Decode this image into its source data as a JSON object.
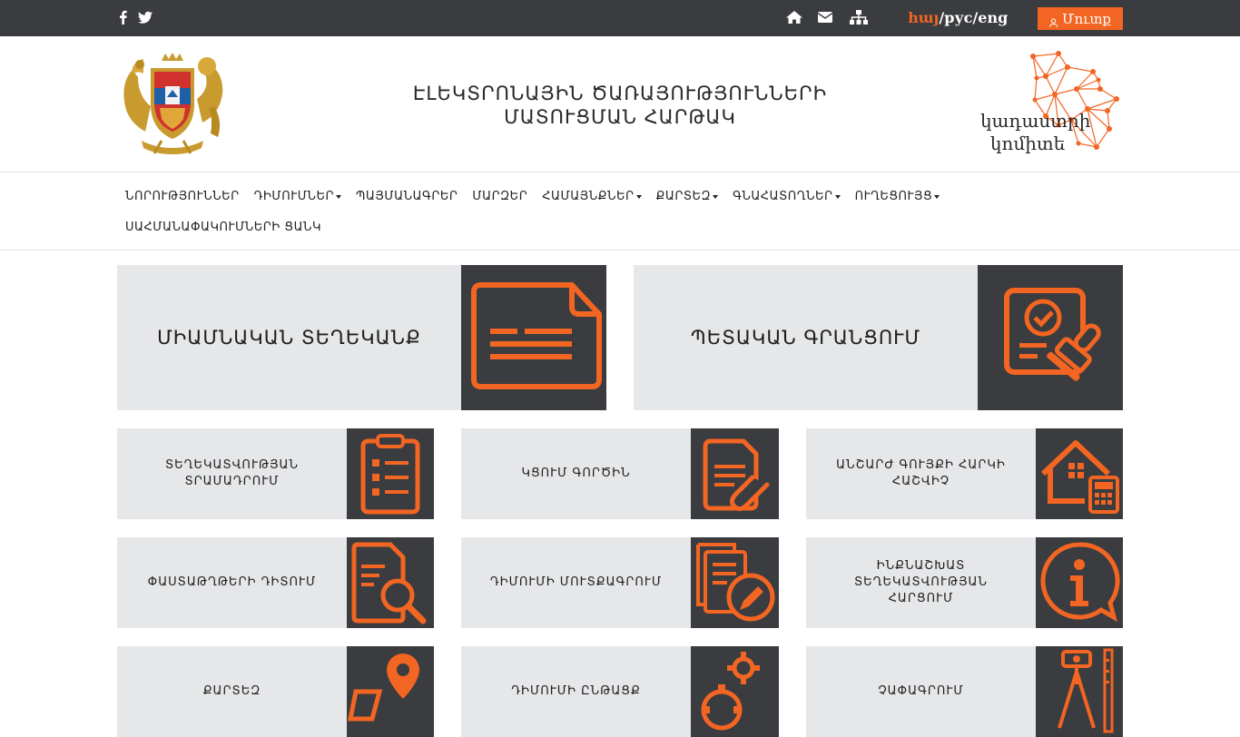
{
  "topbar": {
    "lang_arm": "հայ",
    "lang_sep1": "/",
    "lang_rus": "рус",
    "lang_sep2": "/",
    "lang_eng": "eng",
    "login_label": "Մուտք",
    "social_icons": [
      "facebook-icon",
      "twitter-icon"
    ],
    "util_icons": [
      "home-icon",
      "envelope-icon",
      "sitemap-icon"
    ]
  },
  "header": {
    "title_line1": "ԷԼԵԿՏՐՈՆԱՅԻՆ ԾԱՌԱՅՈՒԹՅՈՒՆՆԵՐԻ",
    "title_line2": "ՄԱՏՈՒՑՄԱՆ ՀԱՐԹԱԿ",
    "brand_line1": "կադաստրի",
    "brand_line2": "կոմիտե"
  },
  "nav": {
    "items": [
      {
        "label": "ՆՈՐՈՒԹՅՈՒՆՆԵՐ",
        "dropdown": false
      },
      {
        "label": "ԴԻՄՈՒՄՆԵՐ",
        "dropdown": true
      },
      {
        "label": "ՊԱՅՄԱՆԱԳՐԵՐ",
        "dropdown": false
      },
      {
        "label": "ՄԱՐԶԵՐ",
        "dropdown": false
      },
      {
        "label": "ՀԱՄԱՅՆՔՆԵՐ",
        "dropdown": true
      },
      {
        "label": "ՔԱՐՏԵԶ",
        "dropdown": true
      },
      {
        "label": "ԳՆԱՀԱՏՈՂՆԵՐ",
        "dropdown": true
      },
      {
        "label": "ՈՒՂԵՑՈՒՅՑ",
        "dropdown": true
      },
      {
        "label": "ՍԱՀՄԱՆԱՓԱԿՈՒՄՆԵՐԻ ՑԱՆԿ",
        "dropdown": false
      }
    ]
  },
  "tiles": {
    "big": [
      {
        "label": "ՄԻԱՄՆԱԿԱՆ ՏԵՂԵԿԱՆՔ",
        "icon": "document-card-icon"
      },
      {
        "label": "ՊԵՏԱԿԱՆ ԳՐԱՆՑՈՒՄ",
        "icon": "stamp-document-icon"
      }
    ],
    "small": [
      {
        "label": "ՏԵՂԵԿԱՏՎՈՒԹՅԱՆ ՏՐԱՄԱԴՐՈՒՄ",
        "icon": "clipboard-list-icon"
      },
      {
        "label": "ԿՑՈՒՄ ԳՈՐԾԻՆ",
        "icon": "document-paperclip-icon"
      },
      {
        "label": "ԱՆՇԱՐԺ ԳՈՒՅՔԻ ՀԱՐԿԻ ՀԱՇՎԻՉ",
        "icon": "house-calculator-icon"
      },
      {
        "label": "ՓԱՍՏԱԹՂԹԵՐԻ ԴԻՏՈՒՄ",
        "icon": "document-search-icon"
      },
      {
        "label": "ԴԻՄՈՒՄԻ ՄՈՒՏՔԱԳՐՈՒՄ",
        "icon": "documents-pencil-icon"
      },
      {
        "label": "ԻՆՔՆԱՇԽԱՏ ՏԵՂԵԿԱՏՎՈՒԹՅԱՆ ՀԱՐՑՈՒՄ",
        "icon": "info-bubble-icon"
      },
      {
        "label": "ՔԱՐՏԵԶ",
        "icon": "map-pin-icon"
      },
      {
        "label": "ԴԻՄՈՒՄԻ ԸՆԹԱՑՔ",
        "icon": "gears-icon"
      },
      {
        "label": "ՉԱՓԱԳՐՈՒՄ",
        "icon": "surveyor-tripod-icon"
      }
    ]
  },
  "colors": {
    "accent": "#f26522",
    "dark": "#3a3c3f",
    "tile_bg": "#e6e7e9"
  }
}
